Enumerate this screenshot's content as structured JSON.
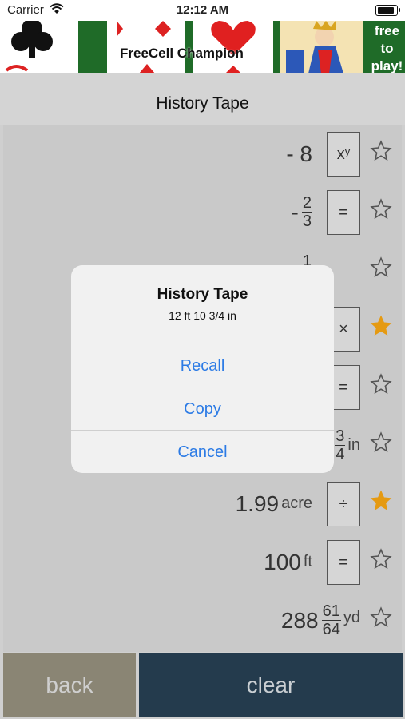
{
  "status": {
    "carrier": "Carrier",
    "time": "12:12 AM"
  },
  "ad": {
    "title": "FreeCell Champion",
    "cta": [
      "free",
      "to",
      "play!"
    ]
  },
  "header": {
    "title": "History Tape"
  },
  "tape": [
    {
      "value": "- 8",
      "op": "xʸ",
      "starred": false
    },
    {
      "value": "-",
      "frac_num": "2",
      "frac_den": "3",
      "op": "=",
      "starred": false
    },
    {
      "value": "",
      "frac_num": "1",
      "frac_den": "4",
      "op": "",
      "starred": false
    },
    {
      "value": "",
      "op": "×",
      "starred": true
    },
    {
      "value": "",
      "op": "=",
      "starred": false
    },
    {
      "value": "",
      "frac_num": "3",
      "frac_den": "4",
      "unit": "in",
      "op": "",
      "starred": false
    },
    {
      "value": "1.99",
      "unit": "acre",
      "op": "÷",
      "starred": true
    },
    {
      "value": "100",
      "unit": "ft",
      "op": "=",
      "starred": false
    },
    {
      "value": "288",
      "frac_num": "61",
      "frac_den": "64",
      "unit": "yd",
      "op": "",
      "starred": false
    }
  ],
  "alert": {
    "title": "History Tape",
    "message": "12 ft 10 3/4 in",
    "recall": "Recall",
    "copy": "Copy",
    "cancel": "Cancel"
  },
  "footer": {
    "back": "back",
    "clear": "clear"
  },
  "colors": {
    "star_filled": "#e59a12",
    "link": "#2c7be5",
    "back_bg": "#8a8574",
    "clear_bg": "#243b4d"
  }
}
